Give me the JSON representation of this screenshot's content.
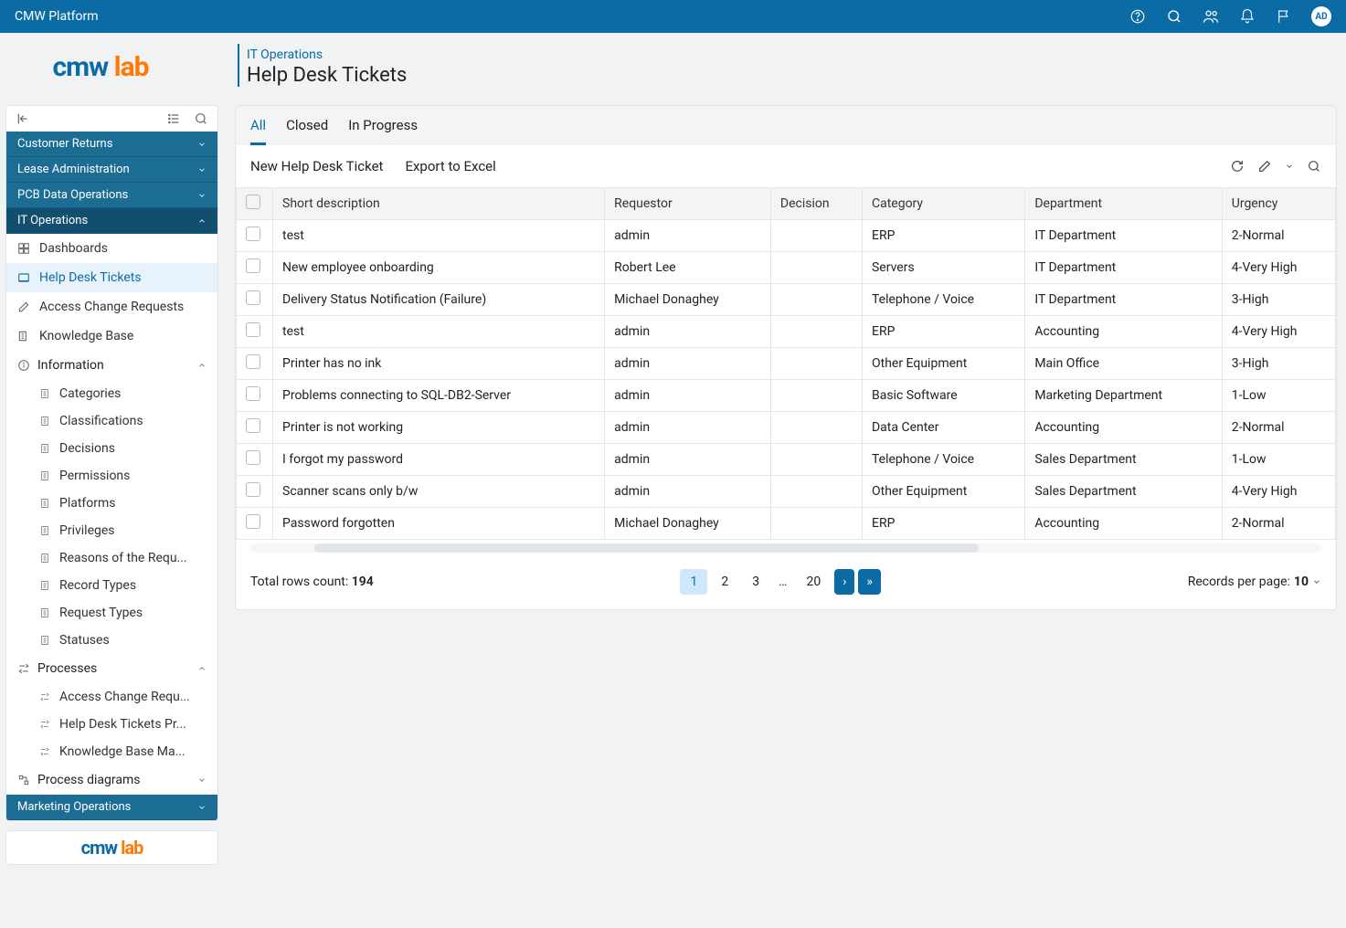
{
  "topbar": {
    "title": "CMW Platform",
    "avatar": "AD"
  },
  "brand": {
    "cmw": "cmw",
    "lab": "lab"
  },
  "breadcrumb": {
    "parent": "IT Operations",
    "title": "Help Desk Tickets"
  },
  "sidebar": {
    "groups_before": [
      "Customer Returns",
      "Lease Administration",
      "PCB Data Operations"
    ],
    "active_group": "IT Operations",
    "items": [
      {
        "label": "Dashboards",
        "active": false
      },
      {
        "label": "Help Desk Tickets",
        "active": true
      },
      {
        "label": "Access Change Requests",
        "active": false
      },
      {
        "label": "Knowledge Base",
        "active": false
      }
    ],
    "info_section": "Information",
    "info_items": [
      "Categories",
      "Classifications",
      "Decisions",
      "Permissions",
      "Platforms",
      "Privileges",
      "Reasons of the Requ...",
      "Record Types",
      "Request Types",
      "Statuses"
    ],
    "processes_section": "Processes",
    "process_items": [
      "Access Change Requ...",
      "Help Desk Tickets Pr...",
      "Knowledge Base Ma..."
    ],
    "process_diagrams": "Process diagrams",
    "groups_after": [
      "Marketing Operations"
    ]
  },
  "tabs": [
    "All",
    "Closed",
    "In Progress"
  ],
  "active_tab": 0,
  "toolbar": {
    "new": "New Help Desk Ticket",
    "export": "Export to Excel"
  },
  "columns": [
    "Short description",
    "Requestor",
    "Decision",
    "Category",
    "Department",
    "Urgency"
  ],
  "rows": [
    {
      "short": "test",
      "req": "admin",
      "dec": "",
      "cat": "ERP",
      "dept": "IT Department",
      "urg": "2-Normal"
    },
    {
      "short": "New employee onboarding",
      "req": "Robert Lee",
      "dec": "",
      "cat": "Servers",
      "dept": "IT Department",
      "urg": "4-Very High"
    },
    {
      "short": "Delivery Status Notification (Failure)",
      "req": "Michael Donaghey",
      "dec": "",
      "cat": "Telephone / Voice",
      "dept": "IT Department",
      "urg": "3-High"
    },
    {
      "short": "test",
      "req": "admin",
      "dec": "",
      "cat": "ERP",
      "dept": "Accounting",
      "urg": "4-Very High"
    },
    {
      "short": "Printer has no ink",
      "req": "admin",
      "dec": "",
      "cat": "Other Equipment",
      "dept": "Main Office",
      "urg": "3-High"
    },
    {
      "short": "Problems connecting to SQL-DB2-Server",
      "req": "admin",
      "dec": "",
      "cat": "Basic Software",
      "dept": "Marketing Department",
      "urg": "1-Low"
    },
    {
      "short": "Printer is not working",
      "req": "admin",
      "dec": "",
      "cat": "Data Center",
      "dept": "Accounting",
      "urg": "2-Normal"
    },
    {
      "short": "I forgot my password",
      "req": "admin",
      "dec": "",
      "cat": "Telephone / Voice",
      "dept": "Sales Department",
      "urg": "1-Low"
    },
    {
      "short": "Scanner scans only b/w",
      "req": "admin",
      "dec": "",
      "cat": "Other Equipment",
      "dept": "Sales Department",
      "urg": "4-Very High"
    },
    {
      "short": "Password forgotten",
      "req": "Michael Donaghey",
      "dec": "",
      "cat": "ERP",
      "dept": "Accounting",
      "urg": "2-Normal"
    }
  ],
  "pager": {
    "count_label": "Total rows count: ",
    "count": "194",
    "pages": [
      "1",
      "2",
      "3",
      "…",
      "20"
    ],
    "perpage_label": "Records per page: ",
    "perpage": "10"
  }
}
